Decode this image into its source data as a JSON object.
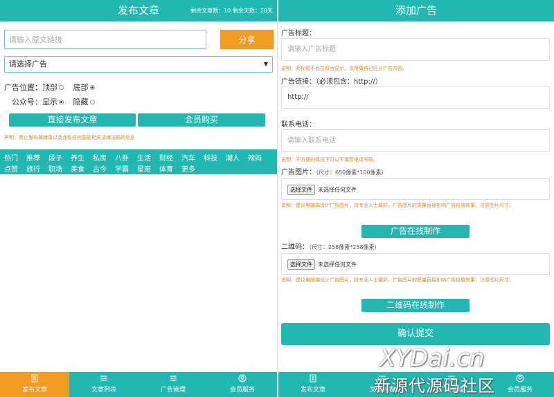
{
  "left": {
    "header": {
      "title": "发布文章",
      "stats": "剩余文章数：10  剩余天数：20天"
    },
    "url_input": {
      "placeholder": "请输入原文链接"
    },
    "share_label": "分享",
    "ad_select": {
      "value": "请选择广告"
    },
    "position": {
      "label": "广告位置：",
      "opt_top": "顶部",
      "opt_bottom": "底部"
    },
    "account": {
      "label": "公众号：",
      "opt_show": "显示",
      "opt_hide": "隐藏"
    },
    "publish_label": "直接发布文章",
    "member_label": "会员购买",
    "notice": "声明：禁止发布黄赌毒以及违反任何国家相关法律法规的信息",
    "categories": [
      "热门",
      "推荐",
      "段子",
      "养生",
      "私房",
      "八卦",
      "生活",
      "财经",
      "汽车",
      "科技",
      "潮人",
      "辣妈",
      "点赞",
      "旅行",
      "职场",
      "美食",
      "古今",
      "学霸",
      "星座",
      "体育",
      "更多"
    ]
  },
  "nav": {
    "items": [
      "发布文章",
      "文章列表",
      "广告管理",
      "会员服务"
    ],
    "active_left": 0
  },
  "right": {
    "header": {
      "title": "添加广告"
    },
    "ad_title": {
      "label": "广告标题：",
      "placeholder": "请输入广告标题",
      "note": "说明：此标题不会在前台显示，仅用做自己区分广告内容。"
    },
    "ad_link": {
      "label": "广告链接：（必须包含：http://）",
      "value": "http://"
    },
    "phone": {
      "label": "联系电话：",
      "placeholder": "请输入联系电话",
      "note": "说明：不方便的情况下可以不填写电话号码。"
    },
    "ad_image": {
      "label": "广告图片：",
      "hint": "（尺寸：650像素*100像素）",
      "choose": "选择文件",
      "none": "未选择任何文件",
      "note": "说明：建议电脑端设计广告图片，找专业人士最好，广告图片的质量直接影响广告投放效果，注意图片尺寸。",
      "tool_label": "广告在线制作"
    },
    "qrcode": {
      "label": "二维码：",
      "hint": "（尺寸：258像素*258像素）",
      "choose": "选择文件",
      "none": "未选择任何文件",
      "note": "说明：建议电脑端设计广告图片，找专业人士最好，广告图片的质量直接影响广告投放效果，注意图片尺寸。",
      "tool_label": "二维码在线制作"
    },
    "submit_label": "确认提交"
  },
  "watermark": {
    "line1": "XYDai.cn",
    "line2": "新源代源码社区"
  },
  "colors": {
    "teal": "#20b8b0",
    "orange": "#f19b20",
    "note": "#e08a1e"
  }
}
